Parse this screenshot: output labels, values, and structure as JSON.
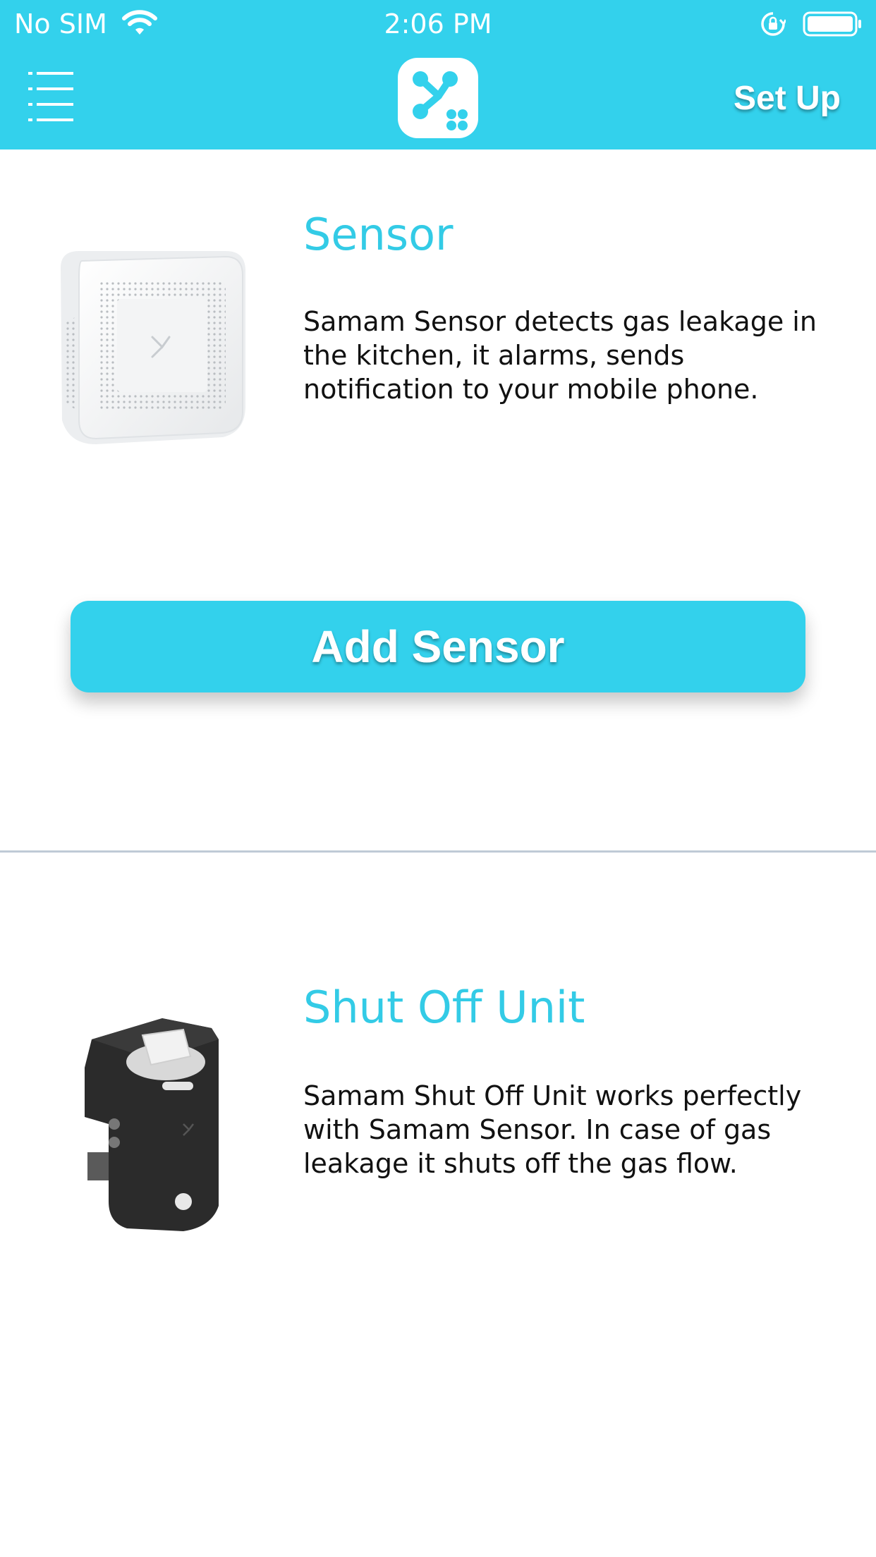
{
  "status_bar": {
    "carrier": "No SIM",
    "time": "2:06 PM"
  },
  "nav": {
    "menu_icon": "menu-list-icon",
    "logo_icon": "samam-logo-icon",
    "setup_label": "Set Up"
  },
  "products": [
    {
      "title": "Sensor",
      "description": "Samam Sensor detects gas leakage in the kitchen, it alarms, sends notification to your mobile phone.",
      "image_icon": "sensor-device-image"
    },
    {
      "title": "Shut Off Unit",
      "description": "Samam Shut Off Unit works perfectly with Samam Sensor. In case of gas leakage it shuts off the gas flow.",
      "image_icon": "shutoff-unit-image"
    }
  ],
  "add_sensor_label": "Add Sensor",
  "colors": {
    "accent": "#33d1ec",
    "title": "#33cbe6",
    "divider": "#bfcad6",
    "text": "#111111"
  }
}
